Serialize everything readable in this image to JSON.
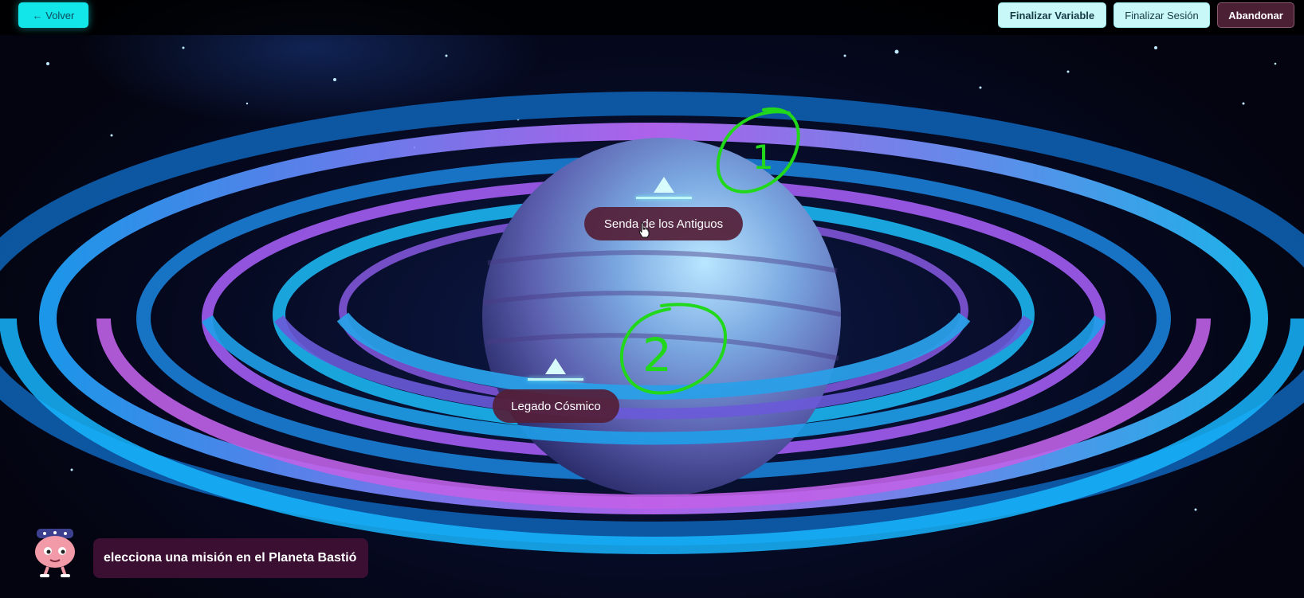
{
  "topbar": {
    "back_label": "← Volver",
    "finalize_variable_label": "Finalizar Variable",
    "finalize_session_label": "Finalizar Sesión",
    "abandon_label": "Abandonar"
  },
  "missions": [
    {
      "label": "Senda de los Antiguos",
      "marker_icon": "triangle-up-icon"
    },
    {
      "label": "Legado Cósmico",
      "marker_icon": "triangle-up-icon"
    }
  ],
  "annotations": [
    "1",
    "2"
  ],
  "narrator": {
    "message": "elecciona una misión en el Planeta Bastió"
  },
  "colors": {
    "accent_cyan": "#12e6e8",
    "button_light": "#c8f8f8",
    "abandon_bg": "#4b1f34",
    "label_bg": "#541e37",
    "annotation_green": "#22d81a"
  }
}
